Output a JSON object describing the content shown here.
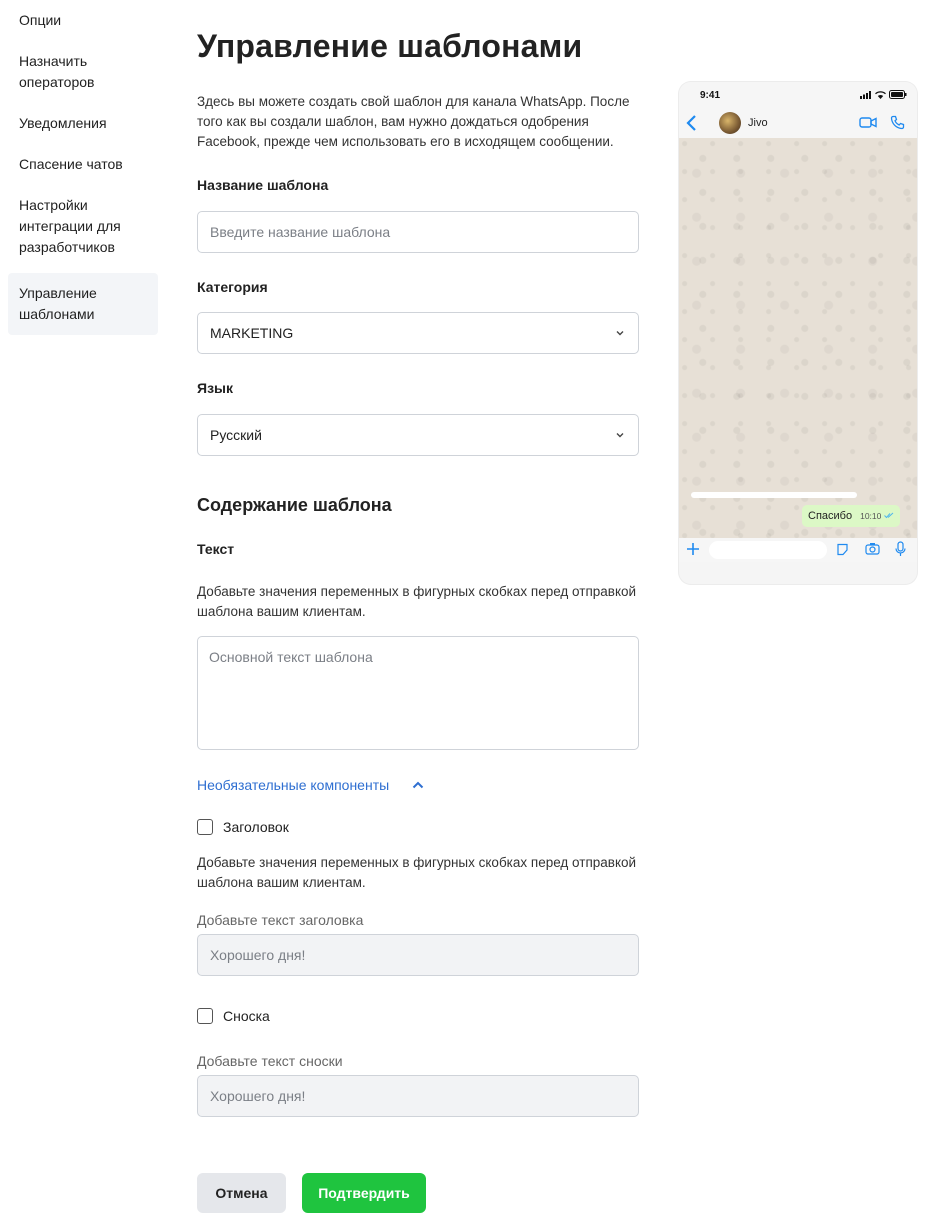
{
  "sidebar": {
    "items": [
      {
        "label": "Опции"
      },
      {
        "label": "Назначить операторов"
      },
      {
        "label": "Уведомления"
      },
      {
        "label": "Спасение чатов"
      },
      {
        "label": "Настройки интеграции для разработчиков"
      },
      {
        "label": "Управление шаблонами",
        "active": true
      }
    ]
  },
  "main": {
    "title": "Управление шаблонами",
    "intro": "Здесь вы можете создать свой шаблон для канала WhatsApp. После того как вы создали шаблон, вам нужно дождаться одобрения Facebook, прежде чем использовать его в исходящем сообщении.",
    "template_name": {
      "label": "Название шаблона",
      "placeholder": "Введите название шаблона"
    },
    "category": {
      "label": "Категория",
      "value": "MARKETING"
    },
    "language": {
      "label": "Язык",
      "value": "Русский"
    },
    "content_title": "Содержание шаблона",
    "text_section": {
      "label": "Текст",
      "help": "Добавьте значения переменных в фигурных скобках перед отправкой шаблона вашим клиентам.",
      "placeholder": "Основной текст шаблона"
    },
    "optional_toggle": "Необязательные компоненты",
    "header_option": {
      "label": "Заголовок",
      "checked": false,
      "help": "Добавьте значения переменных в фигурных скобках перед отправкой шаблона вашим клиентам.",
      "field_label": "Добавьте текст заголовка",
      "value": "Хорошего дня!"
    },
    "footer_option": {
      "label": "Сноска",
      "checked": false,
      "field_label": "Добавьте текст сноски",
      "value": "Хорошего дня!"
    },
    "buttons": {
      "cancel": "Отмена",
      "confirm": "Подтвердить"
    }
  },
  "preview": {
    "time": "9:41",
    "contact": "Jivo",
    "message": "Спасибо",
    "message_time": "10:10"
  },
  "colors": {
    "accent_link": "#2f6fd1",
    "confirm_button": "#1fc43f",
    "cancel_button": "#e5e7eb",
    "active_sidebar": "#f3f5f8",
    "whatsapp_bg": "#e7e0d6",
    "bubble": "#dcf8c6",
    "ios_blue": "#1f8af0"
  },
  "icons": [
    "chevron-down-icon",
    "chevron-up-icon",
    "back-icon",
    "video-icon",
    "phone-icon",
    "plus-icon",
    "sticker-icon",
    "camera-icon",
    "mic-icon",
    "read-check-icon",
    "signal-icon",
    "wifi-icon",
    "battery-icon"
  ]
}
